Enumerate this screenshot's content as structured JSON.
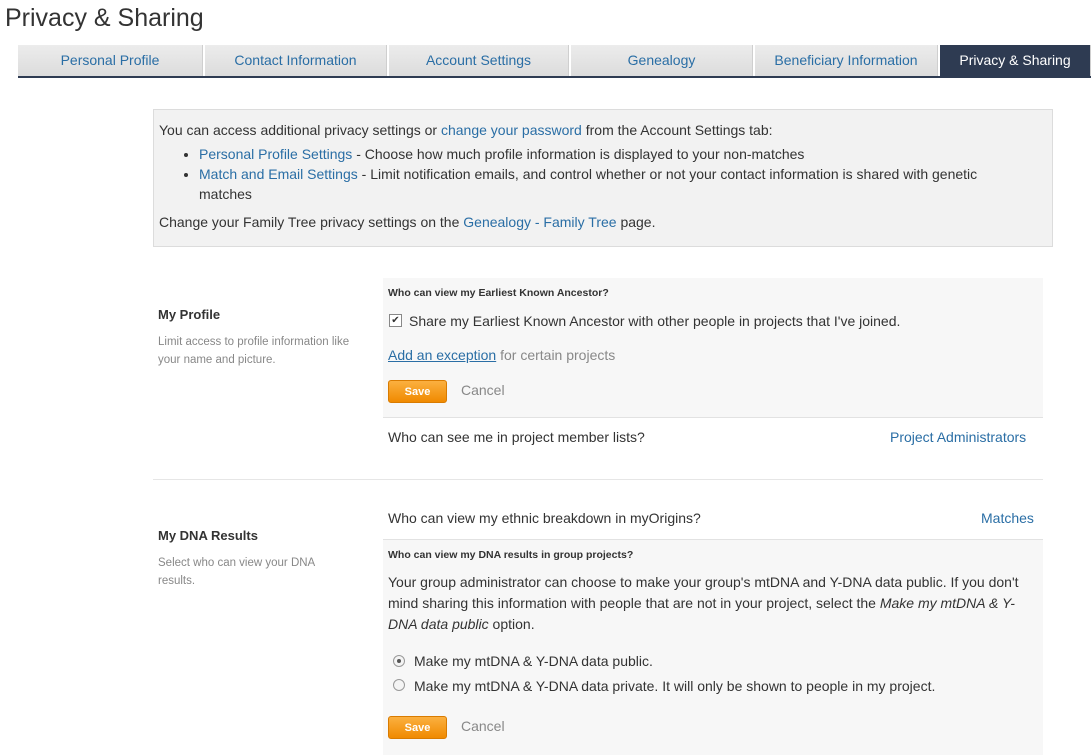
{
  "page": {
    "title": "Privacy & Sharing"
  },
  "tabs": [
    {
      "label": "Personal Profile"
    },
    {
      "label": "Contact Information"
    },
    {
      "label": "Account Settings"
    },
    {
      "label": "Genealogy"
    },
    {
      "label": "Beneficiary Information"
    },
    {
      "label": "Privacy & Sharing",
      "active": true
    }
  ],
  "info": {
    "intro_prefix": "You can access additional privacy settings or ",
    "change_password_link": "change your password",
    "intro_suffix": " from the Account Settings tab:",
    "bullets": [
      {
        "link": "Personal Profile Settings",
        "text": " - Choose how much profile information is displayed to your non-matches"
      },
      {
        "link": "Match and Email Settings",
        "text": " - Limit notification emails, and control whether or not your contact information is shared with genetic matches"
      }
    ],
    "tree_prefix": "Change your Family Tree privacy settings on the ",
    "tree_link": "Genealogy - Family Tree",
    "tree_suffix": " page."
  },
  "my_profile": {
    "label": "My Profile",
    "description": "Limit access to profile information like your name and picture.",
    "ancestor_question": "Who can view my Earliest Known Ancestor?",
    "ancestor_checkbox_label": "Share my Earliest Known Ancestor with other people in projects that I've joined.",
    "ancestor_checked": true,
    "exception_link": "Add an exception",
    "exception_suffix": " for certain projects",
    "save_label": "Save",
    "cancel_label": "Cancel",
    "member_list_question": "Who can see me in project member lists?",
    "member_list_value": "Project Administrators"
  },
  "my_dna": {
    "label": "My DNA Results",
    "description": "Select who can view your DNA results.",
    "ethnic_question": "Who can view my ethnic breakdown in myOrigins?",
    "ethnic_value": "Matches",
    "group_question": "Who can view my DNA results in group projects?",
    "explain_prefix": "Your group administrator can choose to make your group's mtDNA and Y-DNA data public. If you don't mind sharing this information with people that are not in your project, select the ",
    "explain_em": "Make my mtDNA & Y-DNA data public",
    "explain_suffix": " option.",
    "options": [
      {
        "label": "Make my mtDNA & Y-DNA data public.",
        "selected": true
      },
      {
        "label": "Make my mtDNA & Y-DNA data private. It will only be shown to people in my project.",
        "selected": false
      }
    ],
    "save_label": "Save",
    "cancel_label": "Cancel"
  },
  "colors": {
    "accent": "#2a6ea5",
    "active_tab": "#2e3b52",
    "save_button": "#f39c12"
  }
}
